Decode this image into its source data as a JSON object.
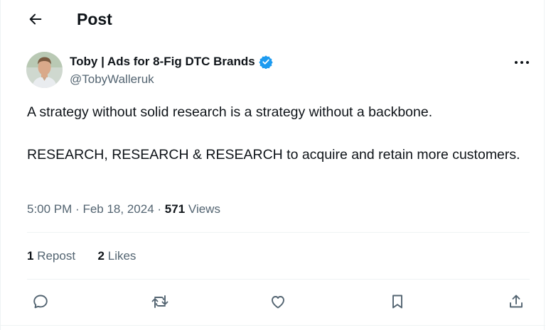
{
  "header": {
    "title": "Post",
    "back_icon": "arrow-left-icon"
  },
  "author": {
    "name": "Toby | Ads for 8-Fig DTC Brands",
    "handle": "@TobyWalleruk",
    "verified": true,
    "verified_color": "#1d9bf0",
    "avatar_icon": "profile-photo"
  },
  "tweet": {
    "paragraph_1": "A strategy without solid research is a strategy without a backbone.",
    "paragraph_2": "RESEARCH, RESEARCH & RESEARCH to acquire and retain more customers."
  },
  "meta": {
    "time": "5:00 PM",
    "separator": "·",
    "date": "Feb 18, 2024",
    "views_count": "571",
    "views_label": "Views"
  },
  "stats": {
    "reposts_count": "1",
    "reposts_label": "Repost",
    "likes_count": "2",
    "likes_label": "Likes"
  },
  "actions": {
    "reply_icon": "reply-icon",
    "repost_icon": "repost-icon",
    "like_icon": "heart-icon",
    "bookmark_icon": "bookmark-icon",
    "share_icon": "share-icon"
  },
  "colors": {
    "text": "#0f1419",
    "secondary": "#536471",
    "accent": "#1d9bf0"
  }
}
